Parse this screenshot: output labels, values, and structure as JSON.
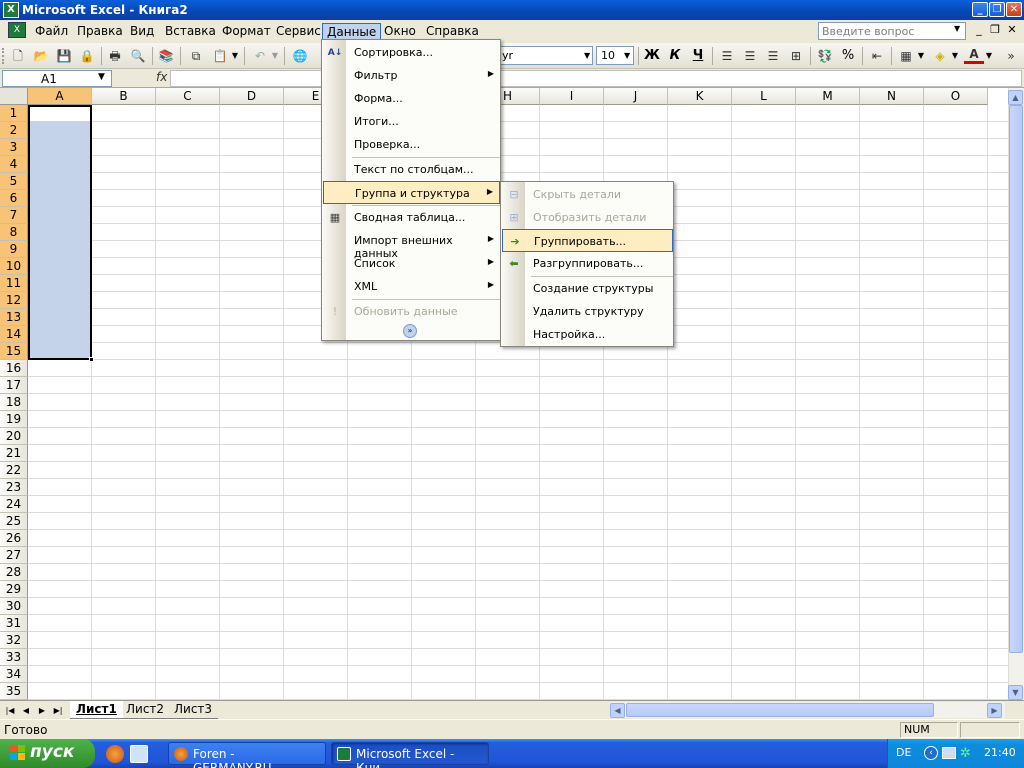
{
  "window": {
    "title": "Microsoft Excel - Книга2",
    "app_icon": "X"
  },
  "menubar": {
    "items": [
      "Файл",
      "Правка",
      "Вид",
      "Вставка",
      "Формат",
      "Сервис",
      "Данные",
      "Окно",
      "Справка"
    ],
    "active": "Данные",
    "help_search_placeholder": "Введите вопрос"
  },
  "toolbar": {
    "font_name": "yr",
    "font_size": "10",
    "bold": "Ж",
    "italic": "К",
    "underline": "Ч",
    "percent": "%"
  },
  "formula_bar": {
    "name_box": "A1",
    "fx": "fx",
    "formula": ""
  },
  "grid": {
    "columns": [
      "A",
      "B",
      "C",
      "D",
      "E",
      "F",
      "G",
      "H",
      "I",
      "J",
      "K",
      "L",
      "M",
      "N",
      "O"
    ],
    "rows": [
      "1",
      "2",
      "3",
      "4",
      "5",
      "6",
      "7",
      "8",
      "9",
      "10",
      "11",
      "12",
      "13",
      "14",
      "15",
      "16",
      "17",
      "18",
      "19",
      "20",
      "21",
      "22",
      "23",
      "24",
      "25",
      "26",
      "27",
      "28",
      "29",
      "30",
      "31",
      "32",
      "33",
      "34",
      "35"
    ],
    "selected_column": "A",
    "selected_rows": [
      "1",
      "2",
      "3",
      "4",
      "5",
      "6",
      "7",
      "8",
      "9",
      "10",
      "11",
      "12",
      "13",
      "14",
      "15"
    ],
    "selection_range": "A1:A15"
  },
  "data_menu": {
    "items": [
      {
        "label": "Сортировка...",
        "icon": "sort-icon",
        "submenu": false,
        "enabled": true
      },
      {
        "label": "Фильтр",
        "submenu": true,
        "enabled": true
      },
      {
        "label": "Форма...",
        "submenu": false,
        "enabled": true
      },
      {
        "label": "Итоги...",
        "submenu": false,
        "enabled": true
      },
      {
        "label": "Проверка...",
        "submenu": false,
        "enabled": true
      },
      {
        "label": "Текст по столбцам...",
        "submenu": false,
        "enabled": true
      },
      {
        "label": "Группа и структура",
        "submenu": true,
        "enabled": true,
        "highlighted": true
      },
      {
        "label": "Сводная таблица...",
        "icon": "pivot-table-icon",
        "submenu": false,
        "enabled": true
      },
      {
        "label": "Импорт внешних данных",
        "submenu": true,
        "enabled": true
      },
      {
        "label": "Список",
        "submenu": true,
        "enabled": true
      },
      {
        "label": "XML",
        "submenu": true,
        "enabled": true
      },
      {
        "label": "Обновить данные",
        "icon": "refresh-icon",
        "submenu": false,
        "enabled": false
      }
    ],
    "expand_icon": "double-chevron-down-icon"
  },
  "group_submenu": {
    "items": [
      {
        "label": "Скрыть детали",
        "icon": "hide-detail-icon",
        "enabled": false
      },
      {
        "label": "Отобразить детали",
        "icon": "show-detail-icon",
        "enabled": false
      },
      {
        "label": "Группировать...",
        "icon": "group-arrow-icon",
        "enabled": true,
        "highlighted": true
      },
      {
        "label": "Разгруппировать...",
        "icon": "ungroup-arrow-icon",
        "enabled": true
      },
      {
        "label": "Создание структуры",
        "enabled": true
      },
      {
        "label": "Удалить структуру",
        "enabled": true
      },
      {
        "label": "Настройка...",
        "enabled": true
      }
    ]
  },
  "sheets": {
    "tabs": [
      "Лист1",
      "Лист2",
      "Лист3"
    ],
    "active": "Лист1"
  },
  "statusbar": {
    "text": "Готово",
    "num": "NUM"
  },
  "taskbar": {
    "start_label": "пуск",
    "buttons": [
      {
        "label": "Foren - GERMANY.RU...",
        "active": false
      },
      {
        "label": "Microsoft Excel - Кни...",
        "active": true
      }
    ],
    "tray_lang": "DE",
    "clock": "21:40"
  },
  "colors": {
    "title_bar": "#0746b4",
    "menu_highlight": "#ffeec2",
    "menu_highlight_border": "#316ac5",
    "selection_fill": "#c5d3ea",
    "header_selected": "#f7c376",
    "taskbar": "#2055d8",
    "start_button": "#3d9b37"
  }
}
